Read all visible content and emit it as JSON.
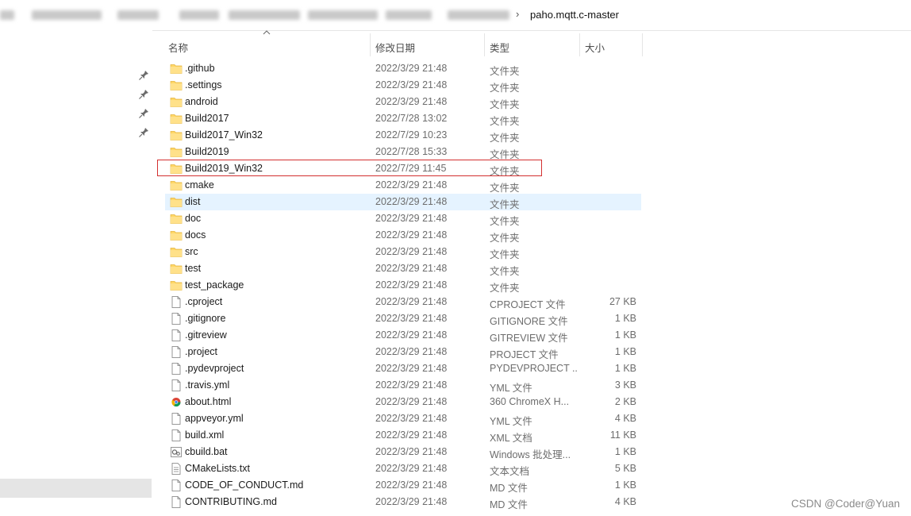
{
  "breadcrumb": {
    "separator": "›",
    "current": "paho.mqtt.c-master"
  },
  "columns": {
    "name": "名称",
    "modified": "修改日期",
    "type": "类型",
    "size": "大小"
  },
  "files": [
    {
      "name": ".github",
      "modified": "2022/3/29 21:48",
      "type": "文件夹",
      "size": "",
      "icon": "folder-icon"
    },
    {
      "name": ".settings",
      "modified": "2022/3/29 21:48",
      "type": "文件夹",
      "size": "",
      "icon": "folder-icon"
    },
    {
      "name": "android",
      "modified": "2022/3/29 21:48",
      "type": "文件夹",
      "size": "",
      "icon": "folder-icon"
    },
    {
      "name": "Build2017",
      "modified": "2022/7/28 13:02",
      "type": "文件夹",
      "size": "",
      "icon": "folder-icon"
    },
    {
      "name": "Build2017_Win32",
      "modified": "2022/7/29 10:23",
      "type": "文件夹",
      "size": "",
      "icon": "folder-icon"
    },
    {
      "name": "Build2019",
      "modified": "2022/7/28 15:33",
      "type": "文件夹",
      "size": "",
      "icon": "folder-icon"
    },
    {
      "name": "Build2019_Win32",
      "modified": "2022/7/29 11:45",
      "type": "文件夹",
      "size": "",
      "icon": "folder-icon"
    },
    {
      "name": "cmake",
      "modified": "2022/3/29 21:48",
      "type": "文件夹",
      "size": "",
      "icon": "folder-icon"
    },
    {
      "name": "dist",
      "modified": "2022/3/29 21:48",
      "type": "文件夹",
      "size": "",
      "icon": "folder-icon"
    },
    {
      "name": "doc",
      "modified": "2022/3/29 21:48",
      "type": "文件夹",
      "size": "",
      "icon": "folder-icon"
    },
    {
      "name": "docs",
      "modified": "2022/3/29 21:48",
      "type": "文件夹",
      "size": "",
      "icon": "folder-icon"
    },
    {
      "name": "src",
      "modified": "2022/3/29 21:48",
      "type": "文件夹",
      "size": "",
      "icon": "folder-icon"
    },
    {
      "name": "test",
      "modified": "2022/3/29 21:48",
      "type": "文件夹",
      "size": "",
      "icon": "folder-icon"
    },
    {
      "name": "test_package",
      "modified": "2022/3/29 21:48",
      "type": "文件夹",
      "size": "",
      "icon": "folder-icon"
    },
    {
      "name": ".cproject",
      "modified": "2022/3/29 21:48",
      "type": "CPROJECT 文件",
      "size": "27 KB",
      "icon": "file-icon"
    },
    {
      "name": ".gitignore",
      "modified": "2022/3/29 21:48",
      "type": "GITIGNORE 文件",
      "size": "1 KB",
      "icon": "file-icon"
    },
    {
      "name": ".gitreview",
      "modified": "2022/3/29 21:48",
      "type": "GITREVIEW 文件",
      "size": "1 KB",
      "icon": "file-icon"
    },
    {
      "name": ".project",
      "modified": "2022/3/29 21:48",
      "type": "PROJECT 文件",
      "size": "1 KB",
      "icon": "file-icon"
    },
    {
      "name": ".pydevproject",
      "modified": "2022/3/29 21:48",
      "type": "PYDEVPROJECT ...",
      "size": "1 KB",
      "icon": "file-icon"
    },
    {
      "name": ".travis.yml",
      "modified": "2022/3/29 21:48",
      "type": "YML 文件",
      "size": "3 KB",
      "icon": "file-icon"
    },
    {
      "name": "about.html",
      "modified": "2022/3/29 21:48",
      "type": "360 ChromeX H...",
      "size": "2 KB",
      "icon": "browser-html-icon"
    },
    {
      "name": "appveyor.yml",
      "modified": "2022/3/29 21:48",
      "type": "YML 文件",
      "size": "4 KB",
      "icon": "file-icon"
    },
    {
      "name": "build.xml",
      "modified": "2022/3/29 21:48",
      "type": "XML 文档",
      "size": "11 KB",
      "icon": "file-icon"
    },
    {
      "name": "cbuild.bat",
      "modified": "2022/3/29 21:48",
      "type": "Windows 批处理...",
      "size": "1 KB",
      "icon": "batch-file-icon"
    },
    {
      "name": "CMakeLists.txt",
      "modified": "2022/3/29 21:48",
      "type": "文本文档",
      "size": "5 KB",
      "icon": "text-file-icon"
    },
    {
      "name": "CODE_OF_CONDUCT.md",
      "modified": "2022/3/29 21:48",
      "type": "MD 文件",
      "size": "1 KB",
      "icon": "file-icon"
    },
    {
      "name": "CONTRIBUTING.md",
      "modified": "2022/3/29 21:48",
      "type": "MD 文件",
      "size": "4 KB",
      "icon": "file-icon"
    }
  ],
  "hover_row": "dist",
  "highlighted_row": "Build2019_Win32",
  "watermark": "CSDN @Coder@Yuan",
  "colors": {
    "folder": "#ffd766",
    "hover_bg": "#e5f3ff",
    "highlight_border": "#d32f2f",
    "nav_selected": "#e5e5e5"
  }
}
